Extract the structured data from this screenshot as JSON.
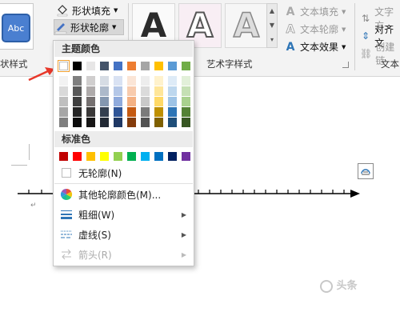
{
  "ribbon": {
    "shape_styles_group": "状样式",
    "abc_label": "Abc",
    "shape_fill": "形状填充",
    "shape_outline": "形状轮廓",
    "wordart_group": "艺术字样式",
    "wordart_letter": "A",
    "text_fill": "文本填充",
    "text_outline": "文本轮廓",
    "text_effects": "文本效果",
    "text_direction": "文字方",
    "align_text": "对齐文",
    "create_link": "创建链",
    "text_group": "文本"
  },
  "menu": {
    "theme_colors_title": "主题颜色",
    "standard_colors_title": "标准色",
    "no_outline": "无轮廓(N)",
    "more_colors": "其他轮廓颜色(M)...",
    "weight": "粗细(W)",
    "dashes": "虚线(S)",
    "arrows": "箭头(R)"
  },
  "theme_colors": {
    "top": [
      "#ffffff",
      "#000000",
      "#e7e6e6",
      "#44546a",
      "#4472c4",
      "#ed7d31",
      "#a5a5a5",
      "#ffc000",
      "#5b9bd5",
      "#70ad47"
    ],
    "shades": [
      [
        "#f2f2f2",
        "#d9d9d9",
        "#bfbfbf",
        "#a6a6a6",
        "#7f7f7f"
      ],
      [
        "#7f7f7f",
        "#595959",
        "#404040",
        "#262626",
        "#0d0d0d"
      ],
      [
        "#d0cece",
        "#aeaaaa",
        "#757070",
        "#3a3838",
        "#171616"
      ],
      [
        "#d6dce4",
        "#acb9ca",
        "#8497b0",
        "#333f4f",
        "#222a35"
      ],
      [
        "#d9e2f3",
        "#b4c7e7",
        "#8faadc",
        "#2f5597",
        "#1f3864"
      ],
      [
        "#fbe5d6",
        "#f8cbad",
        "#f4b183",
        "#c55a11",
        "#843c0c"
      ],
      [
        "#ededed",
        "#dbdbdb",
        "#c9c9c9",
        "#7b7b7b",
        "#525252"
      ],
      [
        "#fff2cc",
        "#ffe699",
        "#ffd966",
        "#bf9000",
        "#7f6000"
      ],
      [
        "#deebf7",
        "#bdd7ee",
        "#9dc3e6",
        "#2e75b6",
        "#1f4e79"
      ],
      [
        "#e2f0d9",
        "#c5e0b4",
        "#a9d18e",
        "#548235",
        "#385723"
      ]
    ]
  },
  "standard_colors": [
    "#c00000",
    "#ff0000",
    "#ffc000",
    "#ffff00",
    "#92d050",
    "#00b050",
    "#00b0f0",
    "#0070c0",
    "#002060",
    "#7030a0"
  ],
  "accent_colors": {
    "annotation_arrow": "#e8382a",
    "selected_swatch_border": "#f0a030"
  },
  "watermark": "头条"
}
